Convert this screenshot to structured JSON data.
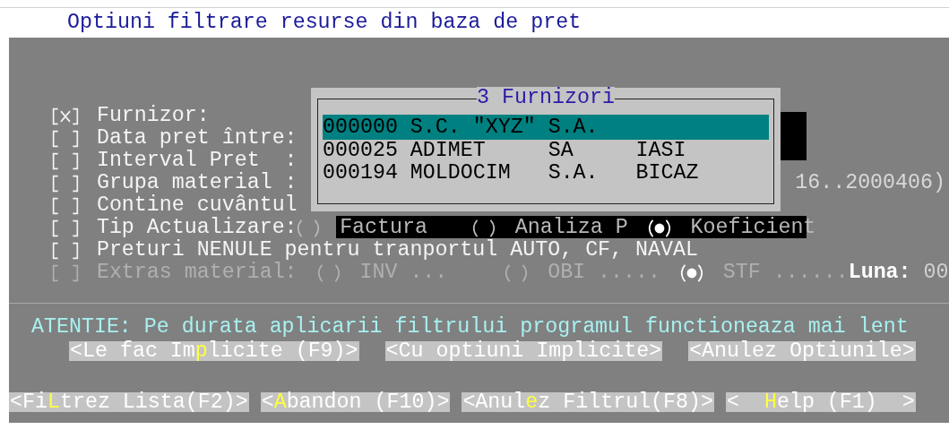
{
  "title": "Optiuni filtrare resurse din baza de pret",
  "options": [
    {
      "kind": "check",
      "checked": true,
      "disabled": false,
      "label": "Furnizor:"
    },
    {
      "kind": "check",
      "checked": false,
      "disabled": false,
      "label": "Data pret între:"
    },
    {
      "kind": "check",
      "checked": false,
      "disabled": false,
      "label": "Interval Pret  :"
    },
    {
      "kind": "check",
      "checked": false,
      "disabled": false,
      "label": "Grupa material :",
      "value": "16..2000406)"
    },
    {
      "kind": "check",
      "checked": false,
      "disabled": false,
      "label": "Contine cuvântul"
    },
    {
      "kind": "radio",
      "checked": false,
      "disabled": false,
      "label": "Tip Actualizare:",
      "choices": [
        {
          "label": "Factura",
          "selected": false
        },
        {
          "label": "Analiza P",
          "selected": false
        },
        {
          "label": "Koeficient",
          "selected": true
        }
      ]
    },
    {
      "kind": "check",
      "checked": false,
      "disabled": false,
      "label": "Preturi NENULE pentru tranportul AUTO, CF, NAVAL"
    },
    {
      "kind": "radio",
      "checked": false,
      "disabled": true,
      "label": "Extras material:",
      "choices": [
        {
          "label": "INV ...",
          "selected": false
        },
        {
          "label": "OBI .....",
          "selected": false
        },
        {
          "label": "STF ......",
          "selected": true
        }
      ],
      "month_label": "Luna:",
      "month_value": "00"
    }
  ],
  "popup": {
    "title": "3 Furnizori",
    "rows": [
      {
        "text": "000000 S.C. \"XYZ\" S.A.",
        "selected": true
      },
      {
        "text": "000025 ADIMET     SA     IASI",
        "selected": false
      },
      {
        "text": "000194 MOLDOCIM   S.A.   BICAZ",
        "selected": false
      }
    ]
  },
  "warning": "ATENTIE: Pe durata aplicarii filtrului programul functioneaza mai lent",
  "button_rows": [
    [
      {
        "before": "<Le fac Im",
        "hotkey": "p",
        "after": "licite (F9)>"
      },
      {
        "before": "<Cu optiuni Implicite>"
      },
      {
        "before": "<Anulez Optiunile>"
      }
    ],
    [
      {
        "before": "<Fi",
        "hotkey": "L",
        "after": "trez Lista(F2)>"
      },
      {
        "before": "<",
        "hotkey": "A",
        "after": "bandon (F10)>"
      },
      {
        "before": "<Anul",
        "hotkey": "e",
        "after": "z Filtrul(F8)>"
      },
      {
        "before": "<  ",
        "hotkey": "H",
        "after": "elp (F1)  >"
      }
    ]
  ]
}
